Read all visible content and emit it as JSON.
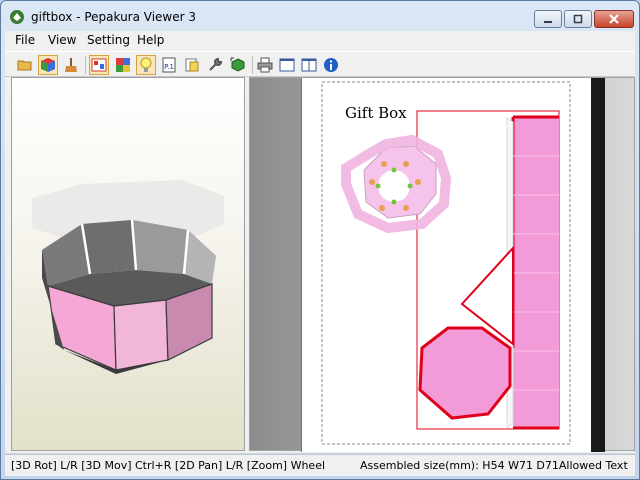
{
  "window": {
    "title": "giftbox - Pepakura Viewer 3"
  },
  "menu": {
    "file": "File",
    "view": "View",
    "setting": "Setting",
    "help": "Help"
  },
  "toolbar": {
    "icons": [
      "open-folder-icon",
      "3d-cube-icon",
      "cleaner-brush-icon",
      "2d-layout-icon",
      "color-cube-icon",
      "lightbulb-icon",
      "page-number-icon",
      "note-icon",
      "wrench-icon",
      "select-face-icon",
      "printer-icon",
      "single-pane-icon",
      "dual-pane-icon",
      "info-icon"
    ]
  },
  "pattern": {
    "title": "Gift Box"
  },
  "status": {
    "left": "[3D Rot] L/R [3D Mov] Ctrl+R [2D Pan] L/R [Zoom] Wheel",
    "right": "Assembled size(mm): H54 W71 D71Allowed Text"
  },
  "colors": {
    "accent_pink": "#f39ad8",
    "cut_line": "#e0001a",
    "box_side": "#f2a8d2"
  }
}
